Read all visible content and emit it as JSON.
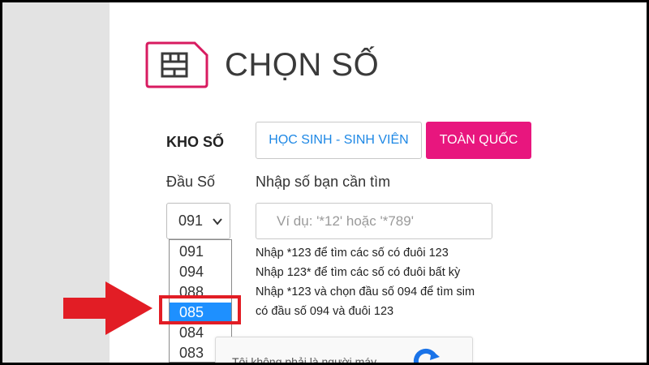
{
  "page": {
    "title": "CHỌN SỐ"
  },
  "icons": {
    "sim": "sim-card-icon",
    "select_chevron": "chevron-down-icon",
    "recaptcha": "recaptcha-icon",
    "pointer": "right-arrow-icon"
  },
  "colors": {
    "accent": "#e8167e",
    "link_blue": "#1e88e5",
    "selected_option": "#1e90ff",
    "annotation_red": "#e21d25"
  },
  "kho_so": {
    "label": "KHO SỐ",
    "buttons": [
      {
        "label": "HỌC SINH - SINH VIÊN"
      },
      {
        "label": "TOÀN QUỐC"
      }
    ]
  },
  "dau_so": {
    "label": "Đầu Số",
    "selected": "091",
    "options": [
      "091",
      "094",
      "088",
      "085",
      "084",
      "083"
    ],
    "highlighted_option": "085"
  },
  "search": {
    "label": "Nhập số bạn cần tìm",
    "placeholder": "Ví dụ: '*12' hoặc '*789'"
  },
  "hints": [
    "Nhập *123 để tìm các số có đuôi 123",
    "Nhập 123* để tìm các số có đuôi bất kỳ",
    "Nhập *123 và chọn đầu số 094 để tìm sim",
    "có đầu số 094 và đuôi 123"
  ],
  "captcha": {
    "label": "Tôi không phải là người máy"
  }
}
